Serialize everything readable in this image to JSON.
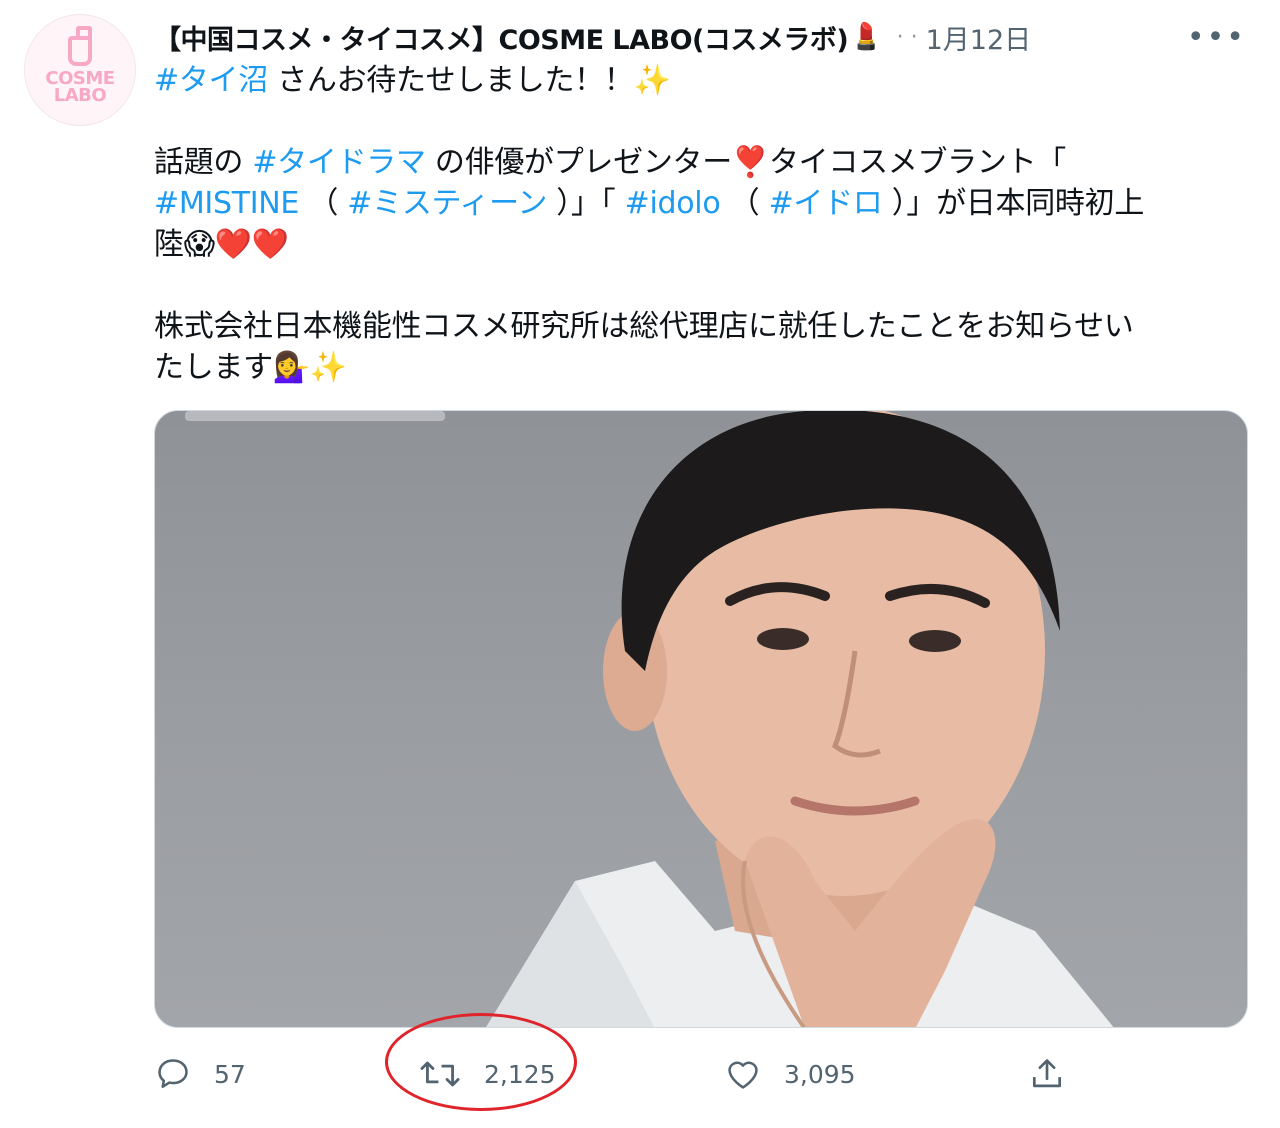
{
  "tweet": {
    "author": {
      "display_name": "【中国コスメ・タイコスメ】COSME LABO(コスメラボ)",
      "name_emoji": "💄",
      "avatar_text": "COSME LABO"
    },
    "separator": "· ·",
    "date": "1月12日",
    "more_label": "•••",
    "lines": {
      "l1_tag": "#タイ沼",
      "l1_text": " さんお待たせしました！！✨",
      "l2_text_a": "話題の ",
      "l2_tag": "#タイドラマ",
      "l2_text_b": " の俳優がプレゼンター❣️タイコスメブラント「",
      "l3_tag_a": "#MISTINE",
      "l3_text_a": " （ ",
      "l3_tag_b": "#ミスティーン",
      "l3_text_b": " ）」「 ",
      "l3_tag_c": "#idolo",
      "l3_text_c": " （ ",
      "l3_tag_d": "#イドロ",
      "l3_text_d": " ）」が日本同時初上",
      "l4_text": "陸😱❤️❤️",
      "l5_text": "株式会社日本機能性コスメ研究所は総代理店に就任したことをお知らせい",
      "l6_text": "たします💁‍♀️✨"
    },
    "media": {
      "background_color": "#989b9f"
    },
    "actions": {
      "reply_count": "57",
      "retweet_count": "2,125",
      "like_count": "3,095"
    },
    "accent_color": "#1d9bf0",
    "highlight_color": "#e0242b"
  }
}
